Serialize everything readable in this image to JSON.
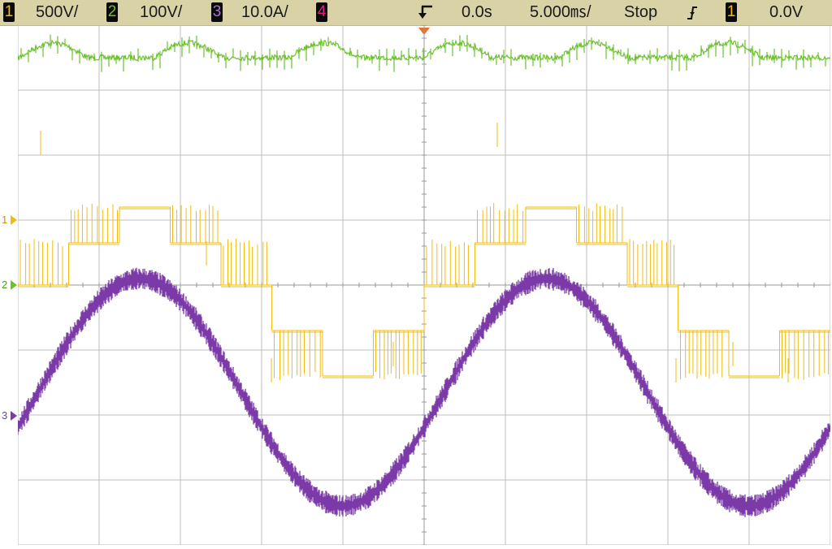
{
  "status_bar": {
    "ch1_num": "1",
    "ch1_scale": "500V/",
    "ch2_num": "2",
    "ch2_scale": "100V/",
    "ch3_num": "3",
    "ch3_scale": "10.0A/",
    "ch4_num": "4",
    "time_offset": "0.0s",
    "time_scale": "5.000㎳/",
    "run_state": "Stop",
    "trigger_source": "1",
    "trigger_level": "0.0V"
  },
  "ground_markers": {
    "ch1": "1",
    "ch2": "2",
    "ch3": "3"
  },
  "colors": {
    "ch1": "#f0bc12",
    "ch2": "#6cc22e",
    "ch3": "#7b3aa8",
    "ch4": "#e0207a",
    "trigger": "#e8702a",
    "grid": "#bfbfbf",
    "statusbar": "#d9d2a6"
  },
  "chart_data": {
    "type": "line",
    "x": {
      "unit": "ms",
      "per_div": 5.0,
      "divisions": 10,
      "range": [
        -25,
        25
      ]
    },
    "y": {
      "divisions": 8
    },
    "grid": true,
    "series": [
      {
        "name": "1",
        "scale_per_div": "500V",
        "waveform": "multilevel PWM staircase",
        "levels_div": [
          1.2,
          0.65,
          0.0,
          -0.7,
          -1.4
        ],
        "step_sequence_div": [
          0,
          0.65,
          1.2,
          0.65,
          0,
          -0.7,
          -1.4,
          -0.7,
          0
        ],
        "period_ms": 25
      },
      {
        "name": "2",
        "scale_per_div": "100V",
        "waveform": "dc with small ripple",
        "offset_div": 3.5,
        "ripple_div": 0.15,
        "period_ms": 8.3
      },
      {
        "name": "3",
        "scale_per_div": "10.0A",
        "waveform": "sinusoid",
        "amplitude_div": 1.4,
        "period_ms": 25,
        "peak_time_ms": -17.5,
        "ground_offset_div": -2
      }
    ]
  }
}
